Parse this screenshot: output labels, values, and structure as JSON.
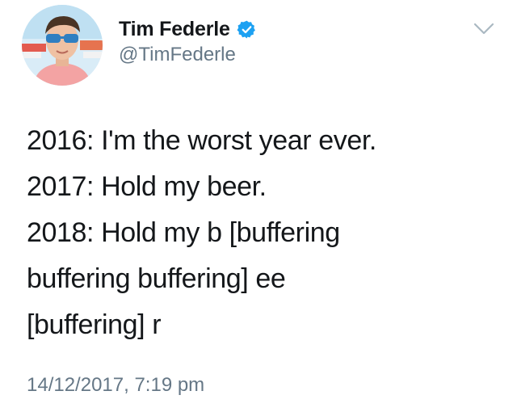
{
  "author": {
    "display_name": "Tim Federle",
    "handle": "@TimFederle",
    "verified": true,
    "verified_icon": "verified-badge-icon",
    "avatar_icon": "avatar"
  },
  "menu": {
    "icon": "chevron-down-icon"
  },
  "tweet": {
    "lines": [
      "2016: I'm the worst year ever.",
      "2017: Hold my beer.",
      "2018: Hold my b [buffering",
      "buffering buffering] ee",
      "[buffering] r"
    ],
    "timestamp": "14/12/2017, 7:19 pm"
  },
  "colors": {
    "text": "#14171a",
    "secondary": "#657786",
    "verified": "#1da1f2",
    "caret": "#aab8c2"
  }
}
